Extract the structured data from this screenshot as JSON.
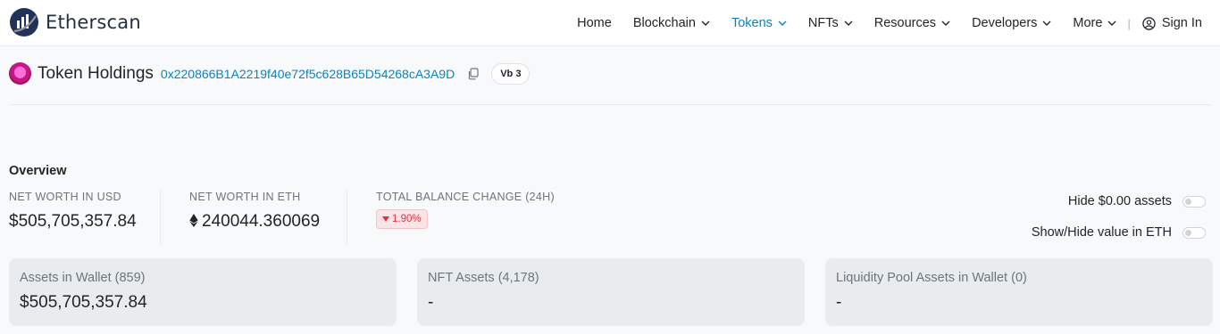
{
  "brand": {
    "name": "Etherscan"
  },
  "nav": {
    "items": [
      {
        "label": "Home"
      },
      {
        "label": "Blockchain"
      },
      {
        "label": "Tokens"
      },
      {
        "label": "NFTs"
      },
      {
        "label": "Resources"
      },
      {
        "label": "Developers"
      },
      {
        "label": "More"
      }
    ],
    "separator": "|",
    "sign_in": "Sign In"
  },
  "header": {
    "title": "Token Holdings",
    "address": "0x220866B1A2219f40e72f5c628B65D54268cA3A9D",
    "badge": "Vb 3"
  },
  "overview": {
    "heading": "Overview",
    "net_worth_usd_label": "NET WORTH IN USD",
    "net_worth_usd": "$505,705,357.84",
    "net_worth_eth_label": "NET WORTH IN ETH",
    "net_worth_eth": "240044.360069",
    "balance_change_label": "TOTAL BALANCE CHANGE (24H)",
    "balance_change": "1.90%"
  },
  "toggles": {
    "hide_zero": "Hide $0.00 assets",
    "show_eth": "Show/Hide value in ETH"
  },
  "cards": [
    {
      "label": "Assets in Wallet (859)",
      "value": "$505,705,357.84"
    },
    {
      "label": "NFT Assets (4,178)",
      "value": "-"
    },
    {
      "label": "Liquidity Pool Assets in Wallet (0)",
      "value": "-"
    }
  ],
  "colors": {
    "accent": "#0784c3",
    "negative": "#dc3545",
    "brand": "#21325b"
  }
}
